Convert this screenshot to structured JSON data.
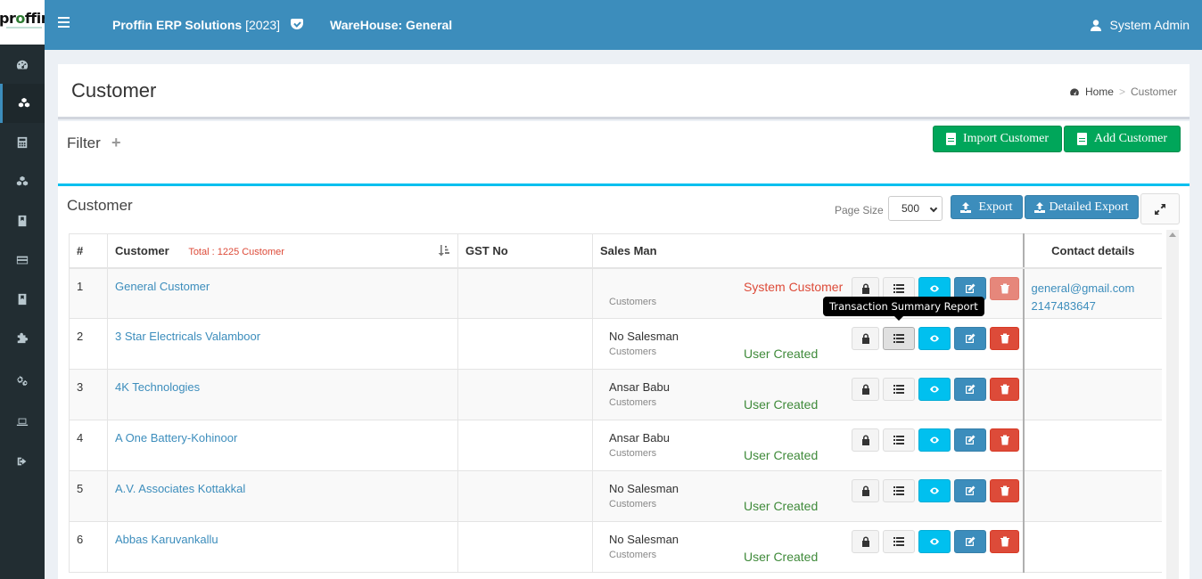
{
  "brand": {
    "logo_text": "proffin"
  },
  "header": {
    "app_name": "Proffin ERP Solutions",
    "app_year": "[2023]",
    "warehouse": "WareHouse: General",
    "user": "System Admin"
  },
  "sidebar": {
    "items": [
      {
        "icon": "dashboard-icon"
      },
      {
        "icon": "cubes-icon",
        "active": true
      },
      {
        "icon": "calculator-icon"
      },
      {
        "icon": "cubes-icon"
      },
      {
        "icon": "book-icon"
      },
      {
        "icon": "credit-card-icon"
      },
      {
        "icon": "book-icon"
      },
      {
        "icon": "puzzle-icon"
      },
      {
        "icon": "cogs-icon"
      },
      {
        "icon": "laptop-icon"
      },
      {
        "icon": "sign-out-icon"
      }
    ]
  },
  "page": {
    "title": "Customer",
    "breadcrumb_home": "Home",
    "breadcrumb_sep": ">",
    "breadcrumb_current": "Customer"
  },
  "filter": {
    "label": "Filter",
    "toggle": "+",
    "import_button": "Import Customer",
    "add_button": "Add Customer"
  },
  "main": {
    "title": "Customer",
    "page_size_label": "Page Size",
    "page_size_value": "500",
    "export_button": "Export",
    "detailed_export_button": "Detailed Export"
  },
  "table": {
    "headers": {
      "num": "#",
      "customer": "Customer",
      "total": "Total : 1225 Customer",
      "gst": "GST No",
      "salesman": "Sales Man",
      "contact": "Contact details"
    },
    "rows": [
      {
        "num": "1",
        "name": "General Customer",
        "gst": "",
        "salesman": "",
        "type": "Customers",
        "status": "System Customer",
        "status_kind": "system",
        "email": "general@gmail.com",
        "phone": "2147483647"
      },
      {
        "num": "2",
        "name": "3 Star Electricals Valamboor",
        "gst": "",
        "salesman": "No Salesman",
        "type": "Customers",
        "status": "User Created",
        "status_kind": "user",
        "email": "",
        "phone": ""
      },
      {
        "num": "3",
        "name": "4K Technologies",
        "gst": "",
        "salesman": "Ansar Babu",
        "type": "Customers",
        "status": "User Created",
        "status_kind": "user",
        "email": "",
        "phone": ""
      },
      {
        "num": "4",
        "name": "A One Battery-Kohinoor",
        "gst": "",
        "salesman": "Ansar Babu",
        "type": "Customers",
        "status": "User Created",
        "status_kind": "user",
        "email": "",
        "phone": ""
      },
      {
        "num": "5",
        "name": "A.V. Associates Kottakkal",
        "gst": "",
        "salesman": "No Salesman",
        "type": "Customers",
        "status": "User Created",
        "status_kind": "user",
        "email": "",
        "phone": ""
      },
      {
        "num": "6",
        "name": "Abbas Karuvankallu",
        "gst": "",
        "salesman": "No Salesman",
        "type": "Customers",
        "status": "User Created",
        "status_kind": "user",
        "email": "",
        "phone": ""
      }
    ]
  },
  "tooltip": {
    "text": "Transaction Summary Report"
  },
  "colors": {
    "header": "#3c8dbc",
    "sidebar": "#222d32",
    "green": "#00a65a",
    "cyan": "#00c0ef",
    "red": "#dd4b39"
  }
}
